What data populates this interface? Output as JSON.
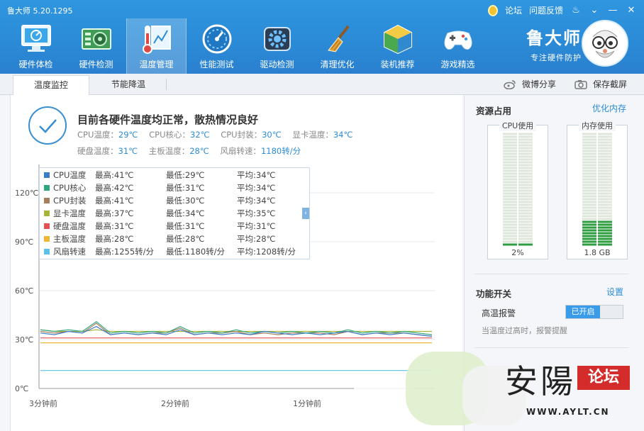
{
  "app": {
    "title": "鲁大师 5.20.1295",
    "brand_name": "鲁大师",
    "brand_sub": "专注硬件防护"
  },
  "topbar": {
    "forum": "论坛",
    "feedback": "问题反馈"
  },
  "toolbar": {
    "items": [
      {
        "label": "硬件体检",
        "icon": "monitor-check-icon"
      },
      {
        "label": "硬件检测",
        "icon": "circuit-board-icon"
      },
      {
        "label": "温度管理",
        "icon": "thermometer-icon"
      },
      {
        "label": "性能测试",
        "icon": "speedometer-icon"
      },
      {
        "label": "驱动检测",
        "icon": "gear-box-icon"
      },
      {
        "label": "清理优化",
        "icon": "broom-icon"
      },
      {
        "label": "装机推荐",
        "icon": "cube-icon"
      },
      {
        "label": "游戏精选",
        "icon": "gamepad-icon"
      }
    ],
    "active_index": 2
  },
  "tabs": {
    "temp_monitor": "温度监控",
    "energy_saving": "节能降温",
    "share_weibo": "微博分享",
    "save_screenshot": "保存截屏"
  },
  "status": {
    "headline": "目前各硬件温度均正常，散热情况良好",
    "items": [
      {
        "label": "CPU温度：",
        "value": "29℃"
      },
      {
        "label": "CPU核心：",
        "value": "32℃"
      },
      {
        "label": "CPU封装：",
        "value": "30℃"
      },
      {
        "label": "显卡温度：",
        "value": "34℃"
      },
      {
        "label": "硬盘温度：",
        "value": "31℃"
      },
      {
        "label": "主板温度：",
        "value": "28℃"
      },
      {
        "label": "风扇转速：",
        "value": "1180转/分"
      }
    ]
  },
  "legend": [
    {
      "name": "CPU温度",
      "max": "最高:41℃",
      "min": "最低:29℃",
      "avg": "平均:34℃",
      "color": "#3d7cc9"
    },
    {
      "name": "CPU核心",
      "max": "最高:42℃",
      "min": "最低:31℃",
      "avg": "平均:34℃",
      "color": "#2ea87a"
    },
    {
      "name": "CPU封装",
      "max": "最高:41℃",
      "min": "最低:30℃",
      "avg": "平均:34℃",
      "color": "#a97c5a"
    },
    {
      "name": "显卡温度",
      "max": "最高:37℃",
      "min": "最低:34℃",
      "avg": "平均:35℃",
      "color": "#a8b437"
    },
    {
      "name": "硬盘温度",
      "max": "最高:31℃",
      "min": "最低:31℃",
      "avg": "平均:31℃",
      "color": "#e05252"
    },
    {
      "name": "主板温度",
      "max": "最高:28℃",
      "min": "最低:28℃",
      "avg": "平均:28℃",
      "color": "#f0b63a"
    },
    {
      "name": "风扇转速",
      "max": "最高:1255转/分",
      "min": "最低:1180转/分",
      "avg": "平均:1208转/分",
      "color": "#5bc0e6"
    }
  ],
  "chart_data": {
    "type": "line",
    "ylim": [
      0,
      120
    ],
    "y_ticks": [
      "0℃",
      "30℃",
      "60℃",
      "90℃",
      "120℃"
    ],
    "x_ticks": [
      "3分钟前",
      "2分钟前",
      "1分钟前"
    ],
    "series": [
      {
        "name": "CPU温度",
        "values": [
          34,
          33,
          35,
          34,
          38,
          33,
          34,
          33,
          34,
          33,
          36,
          33,
          34,
          33,
          34,
          33,
          35,
          34,
          33,
          34,
          33,
          34,
          35,
          33,
          34,
          33,
          34,
          33,
          32
        ]
      },
      {
        "name": "CPU核心",
        "values": [
          36,
          35,
          36,
          35,
          41,
          34,
          35,
          34,
          35,
          34,
          38,
          34,
          35,
          34,
          36,
          34,
          35,
          34,
          35,
          34,
          35,
          34,
          36,
          34,
          35,
          34,
          35,
          34,
          33
        ]
      },
      {
        "name": "CPU封装",
        "values": [
          35,
          34,
          35,
          34,
          40,
          33,
          34,
          33,
          34,
          34,
          37,
          33,
          34,
          34,
          35,
          33,
          34,
          33,
          34,
          34,
          34,
          33,
          35,
          33,
          34,
          34,
          34,
          33,
          32
        ]
      },
      {
        "name": "显卡温度",
        "values": [
          36,
          35,
          35,
          35,
          36,
          35,
          35,
          35,
          35,
          35,
          35,
          35,
          35,
          35,
          35,
          35,
          35,
          35,
          35,
          35,
          35,
          35,
          35,
          35,
          35,
          35,
          35,
          35,
          35
        ]
      },
      {
        "name": "硬盘温度",
        "values": [
          31,
          31,
          31,
          31,
          31,
          31,
          31,
          31,
          31,
          31,
          31,
          31,
          31,
          31,
          31,
          31,
          31,
          31,
          31,
          31,
          31,
          31,
          31,
          31,
          31,
          31,
          31,
          31,
          31
        ]
      },
      {
        "name": "主板温度",
        "values": [
          28,
          28,
          28,
          28,
          28,
          28,
          28,
          28,
          28,
          28,
          28,
          28,
          28,
          28,
          28,
          28,
          28,
          28,
          28,
          28,
          28,
          28,
          28,
          28,
          28,
          28,
          28,
          28,
          28
        ]
      },
      {
        "name": "风扇转速",
        "values": [
          11,
          11,
          11,
          11,
          11,
          11,
          11,
          11,
          11,
          11,
          11,
          11,
          11,
          11,
          11,
          11,
          11,
          11,
          11,
          11,
          11,
          11,
          11,
          11,
          11,
          11,
          11,
          11,
          11
        ]
      }
    ]
  },
  "resources": {
    "title": "资源占用",
    "optimize_link": "优化内存",
    "cpu": {
      "label": "CPU使用",
      "value": "2%",
      "fraction": 0.02
    },
    "memory": {
      "label": "内存使用",
      "value": "1.8 GB",
      "fraction": 0.22
    }
  },
  "functions": {
    "title": "功能开关",
    "settings_link": "设置",
    "alarm_label": "高温报警",
    "alarm_state": "已开启",
    "alarm_hint": "当温度过高时，报警提醒"
  },
  "watermark": {
    "char": "安陽",
    "badge": "论坛",
    "url": "WWW.AYLT.CN"
  }
}
